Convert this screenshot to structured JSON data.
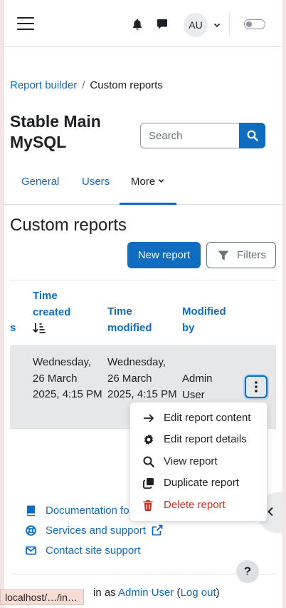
{
  "navbar": {
    "avatar_initials": "AU",
    "icons": [
      "menu-icon",
      "bell-icon",
      "chat-icon",
      "chevron-down-icon",
      "toggle-switch"
    ]
  },
  "breadcrumb": {
    "items": [
      "Report builder",
      "Custom reports"
    ],
    "separator": "/"
  },
  "header": {
    "title": "Stable Main MySQL",
    "search_placeholder": "Search"
  },
  "tabs": {
    "general": "General",
    "users": "Users",
    "more": "More"
  },
  "main": {
    "title": "Custom reports",
    "new_report_label": "New report",
    "filters_label": "Filters"
  },
  "table": {
    "col_partial": "s",
    "col_time_created": "Time created",
    "col_time_modified": "Time modified",
    "col_modified_by": "Modified by",
    "row": {
      "time_created": "Wednesday, 26 March 2025, 4:15 PM",
      "time_modified": "Wednesday, 26 March 2025, 4:15 PM",
      "modified_by": "Admin User"
    }
  },
  "actions_menu": {
    "items": [
      "Edit report content",
      "Edit report details",
      "View report",
      "Duplicate report",
      "Delete report"
    ]
  },
  "footer": {
    "documentation": "Documentation fo",
    "services": "Services and support",
    "contact": "Contact site support",
    "help": "?",
    "logged_in_prefix": "in as",
    "user": "Admin User",
    "logout": "Log out"
  },
  "status_bar": {
    "url": "localhost/…/in…"
  },
  "colors": {
    "primary": "#0f6cbf",
    "danger": "#ca3120",
    "row_highlight": "#e6e7e8"
  }
}
